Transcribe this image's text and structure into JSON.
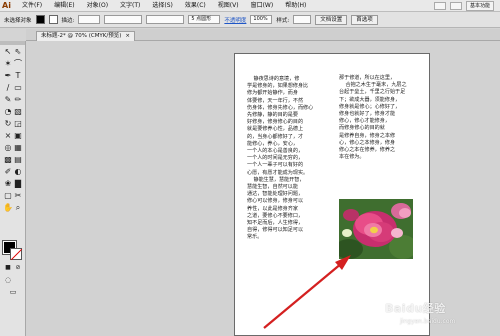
{
  "app": {
    "logo": "Ai"
  },
  "menu": {
    "items": [
      "文件(F)",
      "编辑(E)",
      "对象(O)",
      "文字(T)",
      "选择(S)",
      "效果(C)",
      "视图(V)",
      "窗口(W)",
      "帮助(H)"
    ],
    "workspace": "基本功能"
  },
  "control": {
    "selection_label": "未选择对象",
    "stroke_label": "描边:",
    "point_label": "5 点圆形",
    "opacity_link": "不透明度",
    "opacity_value": "100%",
    "style_label": "样式:",
    "doc_setup": "文档设置",
    "prefs": "首选项"
  },
  "tab": {
    "title": "未标题-2* @ 70% (CMYK/预览)",
    "close": "×"
  },
  "document": {
    "left_column": "    静夜思诗的意境，修\n学是修身的，如果想修身比\n修为都开始静作，而身\n体要修，天一年行，不然\n伤身体，修身先修心，而修心\n先修静，静的目的是要\n好修身，修身修心的目的\n就是要修养心性，品德上\n的，当身心都修好了，才\n能修心，养心，安心，\n一个人的本心是善良的，\n一个人的时间是无穷的，\n一个人一辈子可以有好的\n心愿，有愿才能成为现实。\n    静能生慧，慧能开智，\n慧能生智，自然可以能\n通达，智能处理好问题，\n修心可以修身，修身可以\n养性，以此是修身齐家\n之道，要修心不要修口，\n知不足而后，人生修得，\n自得，修得可以知足可以\n常乐。",
    "right_column_top": "那于修道，所以在这里，\n    合抱之木生于毫末，九层之\n台起于垒土，千里之行始于足\n下；欲成大器，须能修身，\n修身就是修心；心修好了，\n修身也就好了，修身才能\n修心，修心才能修身，\n而修身修心的目的就\n是修养自身，修身之本修\n心，修心之本修身，修身\n修心之本在修养，修养之\n本在修为。"
  },
  "watermark": {
    "brand": "Baidu经验",
    "sub": "jingyan.baidu.com"
  },
  "colors": {
    "artboard": "#ffffff",
    "arrow": "#d42020",
    "fill": "#000000"
  }
}
